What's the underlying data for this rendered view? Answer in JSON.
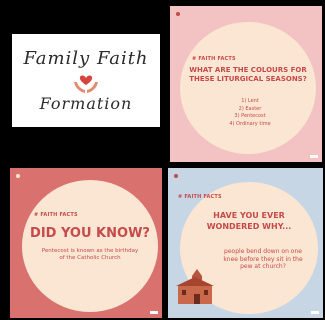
{
  "logo": {
    "line1": "Family Faith",
    "line2": "Formation"
  },
  "seasons_card": {
    "tag": "# FAITH FACTS",
    "headline": "WHAT ARE THE COLOURS FOR THESE LITURGICAL SEASONS?",
    "items": [
      "1) Lent",
      "2) Easter",
      "3) Pentecost",
      "4) Ordinary time"
    ],
    "colors": {
      "bg": "#f3c2c2",
      "blob": "#fbe6d3",
      "headline": "#c64a4a",
      "items": "#c64a4a"
    }
  },
  "dyk_card": {
    "tag": "# FAITH FACTS",
    "headline": "DID YOU KNOW?",
    "body": "Pentecost is known as the birthday of the Catholic Church",
    "colors": {
      "bg": "#d9716f",
      "blob": "#fbe6d3",
      "headline": "#c64a4a",
      "body": "#c64a4a"
    }
  },
  "wonder_card": {
    "tag": "# FAITH FACTS",
    "headline": "HAVE YOU EVER WONDERED WHY...",
    "body": "people bend down on one knee before they sit in the pew at church?",
    "colors": {
      "bg": "#c7d6e4",
      "blob": "#fbe6d3",
      "headline": "#c64a4a",
      "body": "#c64a4a"
    }
  }
}
